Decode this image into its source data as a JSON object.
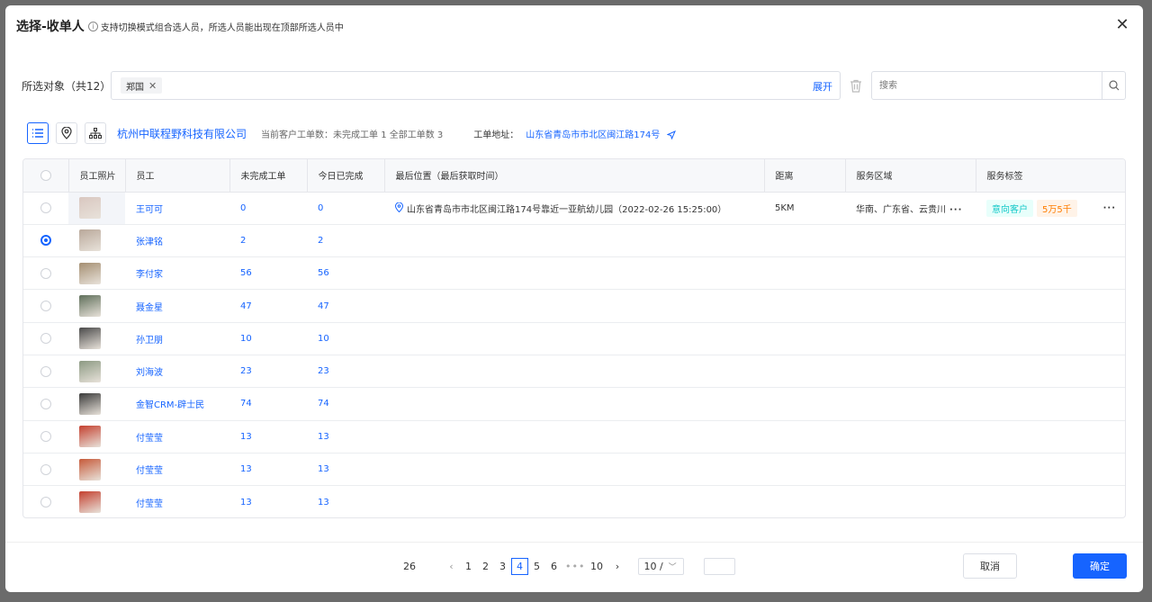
{
  "modal": {
    "title": "选择-收单人",
    "hint": "支持切换模式组合选人员，所选人员能出现在顶部所选人员中"
  },
  "selected": {
    "label": "所选对象（共12）",
    "tags": [
      "郑国"
    ],
    "expand": "展开",
    "search_placeholder": "搜索"
  },
  "toolbar": {
    "company": "杭州中联程野科技有限公司",
    "counts": "当前客户工单数：未完成工单 1   全部工单数 3",
    "address_label": "工单地址：",
    "address": "山东省青岛市市北区闽江路174号"
  },
  "table": {
    "headers": [
      "",
      "员工照片",
      "员工",
      "未完成工单",
      "今日已完成",
      "最后位置（最后获取时间）",
      "距离",
      "服务区域",
      "服务标签"
    ],
    "rows": [
      {
        "name": "王可可",
        "pending": "0",
        "done": "0",
        "location": "山东省青岛市市北区闽江路174号靠近一亚航幼儿园（2022-02-26 15:25:00）",
        "distance": "5KM",
        "area": "华南、广东省、云贵川",
        "tags": [
          "意向客户",
          "5万5千"
        ],
        "checked": false
      },
      {
        "name": "张津铭",
        "pending": "2",
        "done": "2",
        "checked": true
      },
      {
        "name": "李付家",
        "pending": "56",
        "done": "56",
        "checked": false
      },
      {
        "name": "聂金星",
        "pending": "47",
        "done": "47",
        "checked": false
      },
      {
        "name": "孙卫朋",
        "pending": "10",
        "done": "10",
        "checked": false
      },
      {
        "name": "刘海波",
        "pending": "23",
        "done": "23",
        "checked": false
      },
      {
        "name": "金智CRM-辟士民",
        "pending": "74",
        "done": "74",
        "checked": false
      },
      {
        "name": "付莹莹",
        "pending": "13",
        "done": "13",
        "checked": false
      },
      {
        "name": "付莹莹",
        "pending": "13",
        "done": "13",
        "checked": false
      },
      {
        "name": "付莹莹",
        "pending": "13",
        "done": "13",
        "checked": false
      }
    ]
  },
  "pagination": {
    "total": "26",
    "pages": [
      "1",
      "2",
      "3",
      "4",
      "5",
      "6"
    ],
    "current": "4",
    "last": "10",
    "page_size": "10 /"
  },
  "buttons": {
    "cancel": "取消",
    "confirm": "确定"
  },
  "colors": {
    "primary": "#1664ff",
    "tag_green": "#14c9c9",
    "tag_orange": "#ff7d00"
  }
}
